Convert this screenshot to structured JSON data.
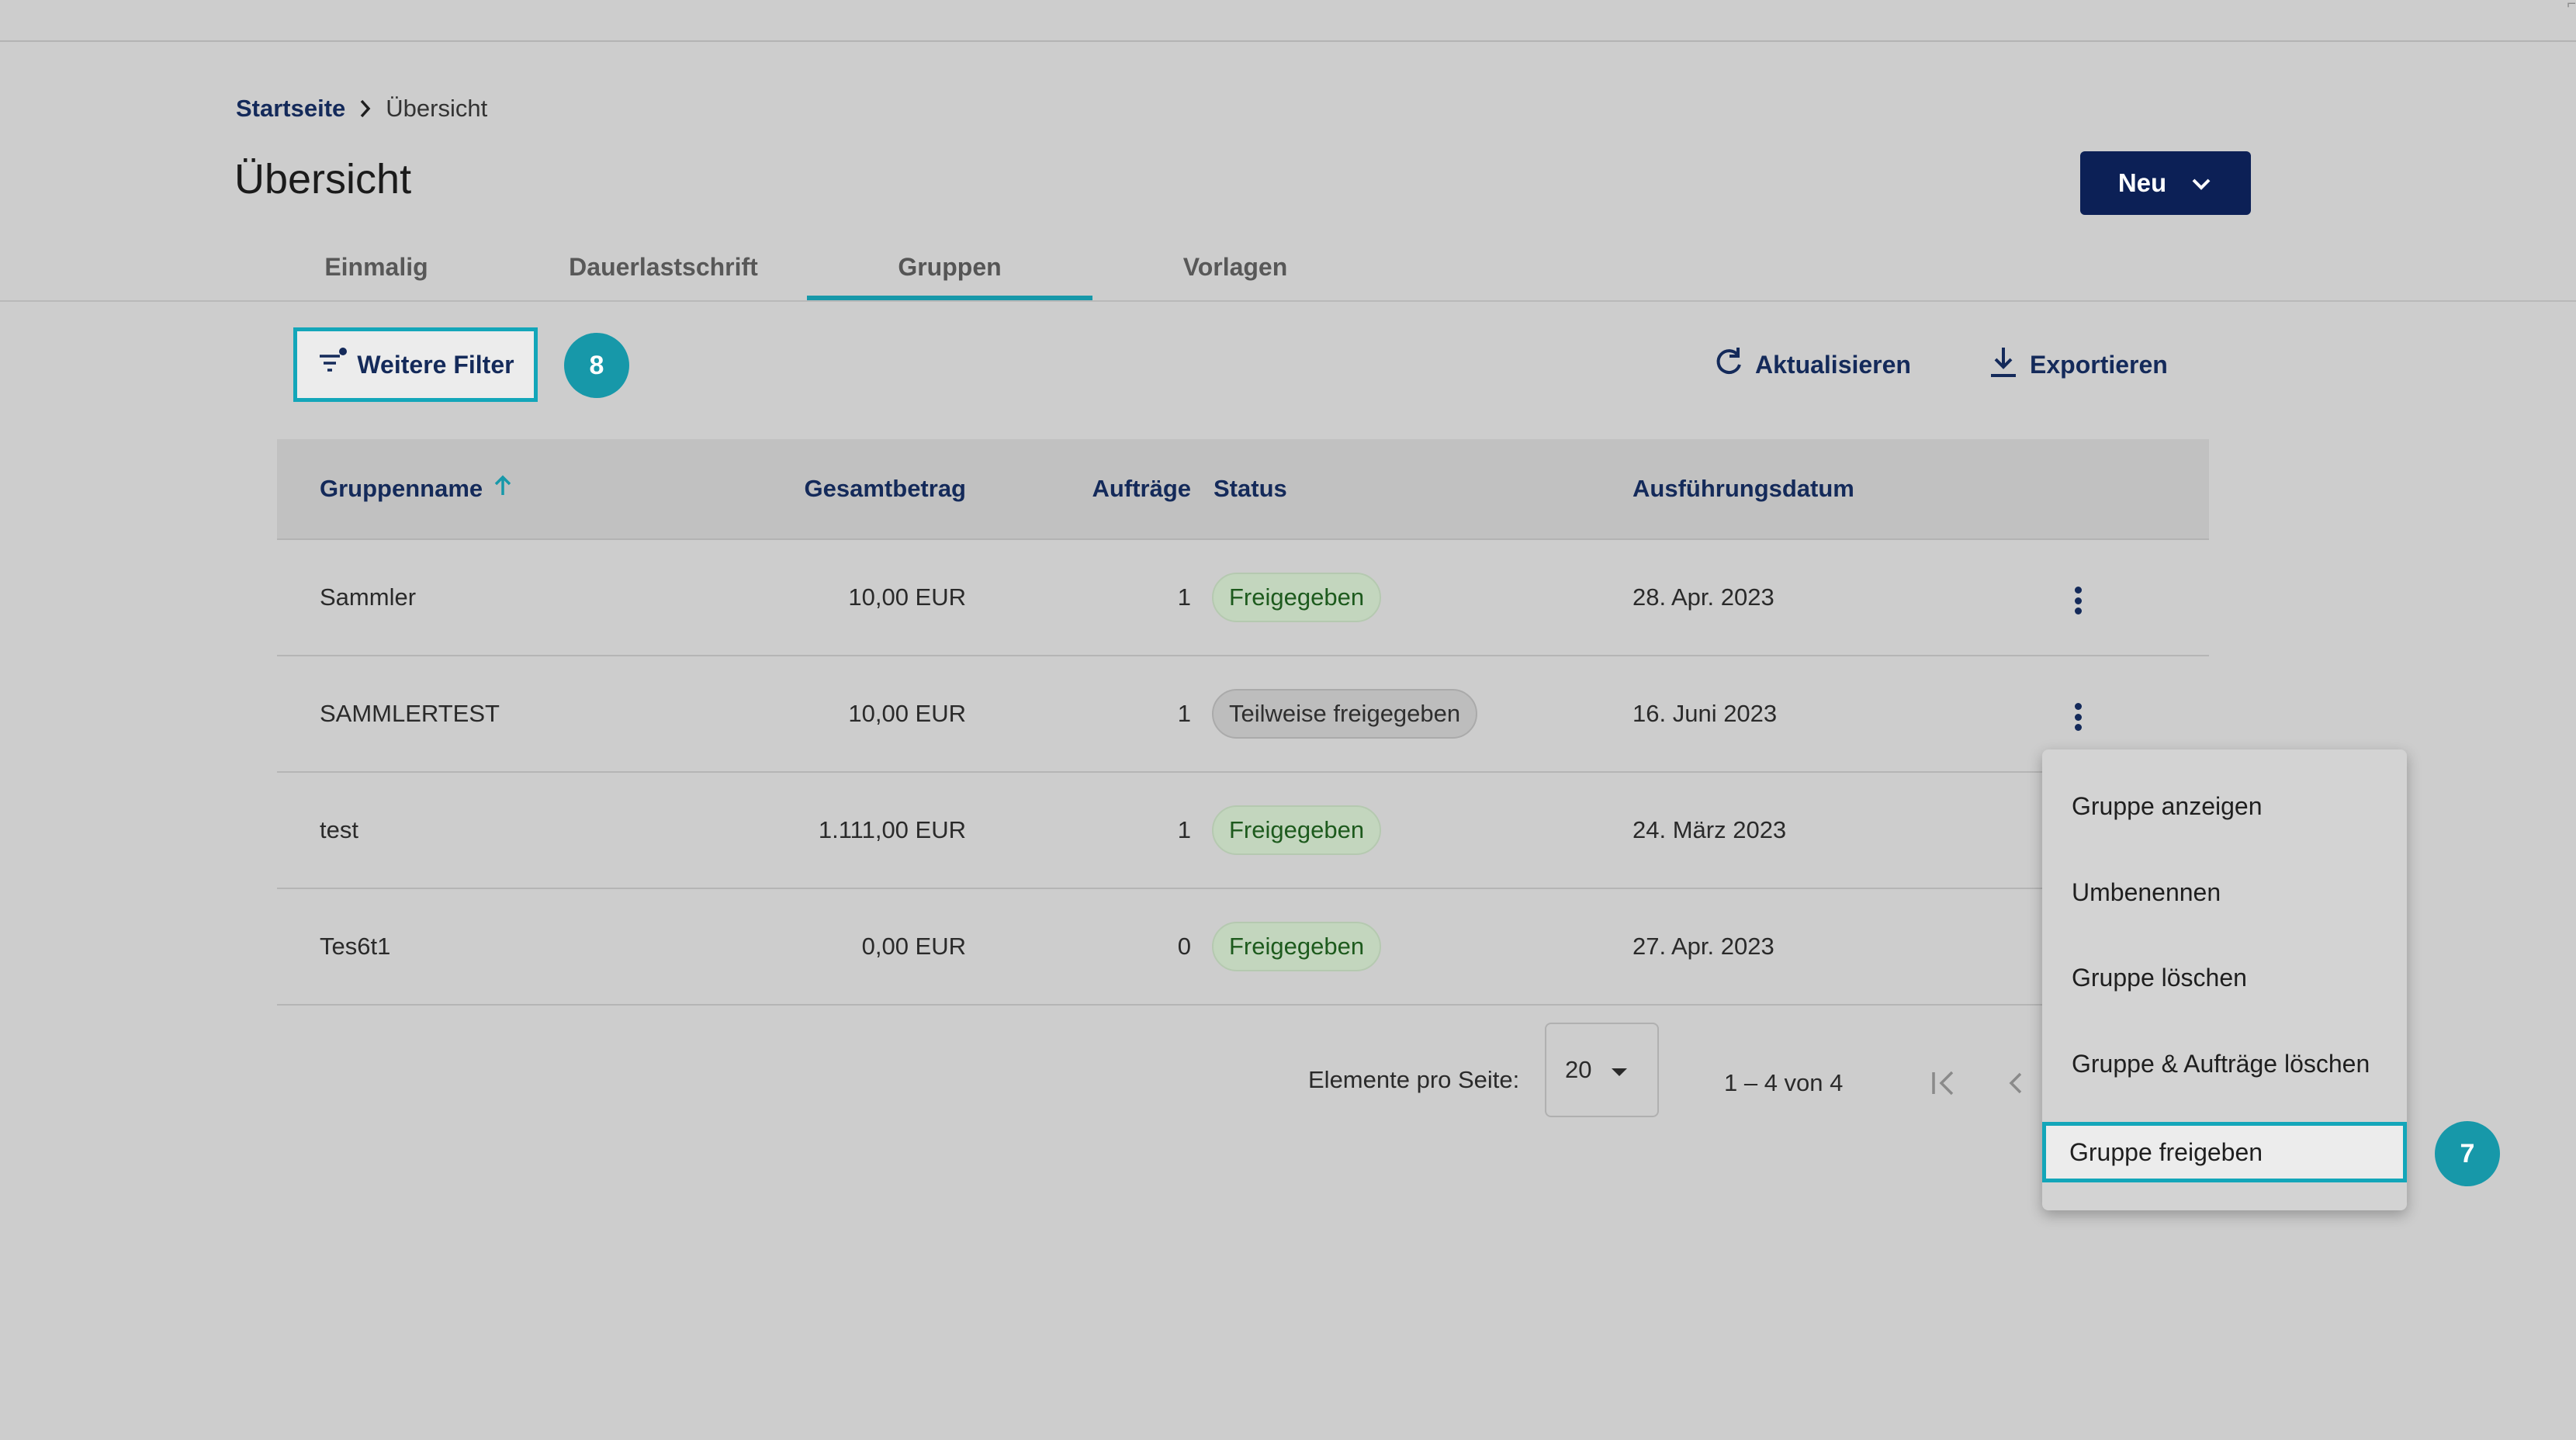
{
  "breadcrumb": {
    "home": "Startseite",
    "current": "Übersicht"
  },
  "page_title": "Übersicht",
  "new_button": {
    "label": "Neu"
  },
  "tabs": [
    {
      "label": "Einmalig",
      "active": false
    },
    {
      "label": "Dauerlastschrift",
      "active": false
    },
    {
      "label": "Gruppen",
      "active": true
    },
    {
      "label": "Vorlagen",
      "active": false
    }
  ],
  "toolbar": {
    "filter_label": "Weitere Filter",
    "filter_badge": "8",
    "refresh_label": "Aktualisieren",
    "export_label": "Exportieren"
  },
  "table": {
    "columns": {
      "name": "Gruppenname",
      "amount": "Gesamtbetrag",
      "orders": "Aufträge",
      "status": "Status",
      "date": "Ausführungsdatum"
    },
    "sort": {
      "column": "Gruppenname",
      "direction": "ascending"
    },
    "rows": [
      {
        "name": "Sammler",
        "amount": "10,00 EUR",
        "orders": "1",
        "status": "Freigegeben",
        "status_kind": "approved",
        "date": "28. Apr. 2023"
      },
      {
        "name": "SAMMLERTEST",
        "amount": "10,00 EUR",
        "orders": "1",
        "status": "Teilweise freigegeben",
        "status_kind": "partial",
        "date": "16. Juni 2023"
      },
      {
        "name": "test",
        "amount": "1.111,00 EUR",
        "orders": "1",
        "status": "Freigegeben",
        "status_kind": "approved",
        "date": "24. März 2023"
      },
      {
        "name": "Tes6t1",
        "amount": "0,00 EUR",
        "orders": "0",
        "status": "Freigegeben",
        "status_kind": "approved",
        "date": "27. Apr. 2023"
      }
    ]
  },
  "pagination": {
    "per_page_label": "Elemente pro Seite:",
    "per_page_value": "20",
    "range": "1 – 4 von 4"
  },
  "context_menu": {
    "items": [
      {
        "label": "Gruppe anzeigen"
      },
      {
        "label": "Umbenennen"
      },
      {
        "label": "Gruppe löschen"
      },
      {
        "label": "Gruppe & Aufträge löschen"
      },
      {
        "label": "Gruppe freigeben",
        "focused": true
      }
    ],
    "badge": "7"
  },
  "colors": {
    "primary": "#0c2056",
    "accent": "#1798a9",
    "focus_outline": "#13a6b9",
    "chip_approved_bg": "#c3d6be",
    "chip_partial_bg": "#bdbdbd"
  }
}
